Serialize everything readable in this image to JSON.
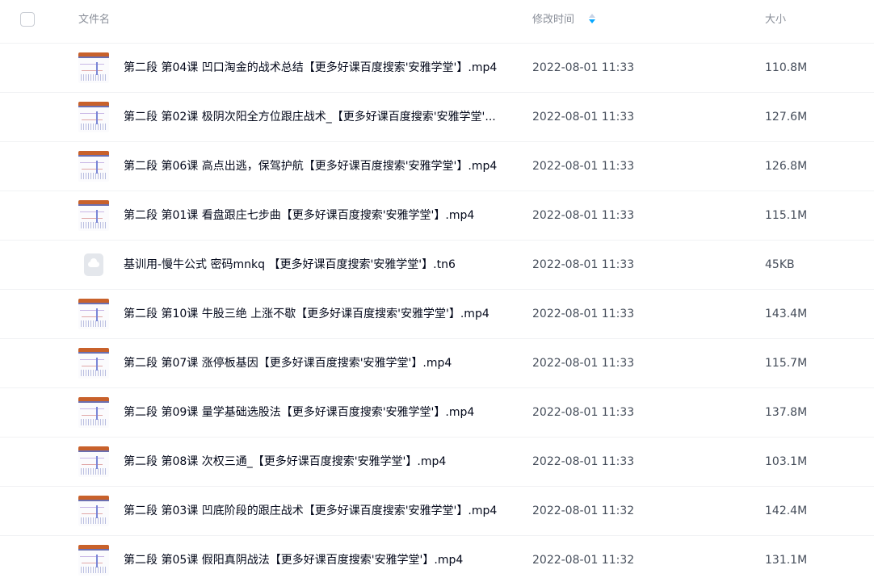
{
  "header": {
    "name_label": "文件名",
    "time_label": "修改时间",
    "size_label": "大小",
    "sort_color": "#06a7ff"
  },
  "files": [
    {
      "name": "第二段 第04课 凹口淘金的战术总结【更多好课百度搜索'安雅学堂'】.mp4",
      "time": "2022-08-01 11:33",
      "size": "110.8M",
      "icon": "video-thumbnail"
    },
    {
      "name": "第二段 第02课 极阴次阳全方位跟庄战术_【更多好课百度搜索'安雅学堂'...",
      "time": "2022-08-01 11:33",
      "size": "127.6M",
      "icon": "video-thumbnail"
    },
    {
      "name": "第二段 第06课 高点出逃，保驾护航【更多好课百度搜索'安雅学堂'】.mp4",
      "time": "2022-08-01 11:33",
      "size": "126.8M",
      "icon": "video-thumbnail"
    },
    {
      "name": "第二段 第01课 看盘跟庄七步曲【更多好课百度搜索'安雅学堂'】.mp4",
      "time": "2022-08-01 11:33",
      "size": "115.1M",
      "icon": "video-thumbnail"
    },
    {
      "name": "基训用-慢牛公式 密码mnkq 【更多好课百度搜索'安雅学堂'】.tn6",
      "time": "2022-08-01 11:33",
      "size": "45KB",
      "icon": "cloud-file-icon"
    },
    {
      "name": "第二段 第10课 牛股三绝 上涨不歇【更多好课百度搜索'安雅学堂'】.mp4",
      "time": "2022-08-01 11:33",
      "size": "143.4M",
      "icon": "video-thumbnail"
    },
    {
      "name": "第二段 第07课 涨停板基因【更多好课百度搜索'安雅学堂'】.mp4",
      "time": "2022-08-01 11:33",
      "size": "115.7M",
      "icon": "video-thumbnail"
    },
    {
      "name": "第二段 第09课 量学基础选股法【更多好课百度搜索'安雅学堂'】.mp4",
      "time": "2022-08-01 11:33",
      "size": "137.8M",
      "icon": "video-thumbnail"
    },
    {
      "name": "第二段 第08课 次权三通_【更多好课百度搜索'安雅学堂'】.mp4",
      "time": "2022-08-01 11:33",
      "size": "103.1M",
      "icon": "video-thumbnail"
    },
    {
      "name": "第二段 第03课 凹底阶段的跟庄战术【更多好课百度搜索'安雅学堂'】.mp4",
      "time": "2022-08-01 11:32",
      "size": "142.4M",
      "icon": "video-thumbnail"
    },
    {
      "name": "第二段 第05课 假阳真阴战法【更多好课百度搜索'安雅学堂'】.mp4",
      "time": "2022-08-01 11:32",
      "size": "131.1M",
      "icon": "video-thumbnail"
    }
  ]
}
